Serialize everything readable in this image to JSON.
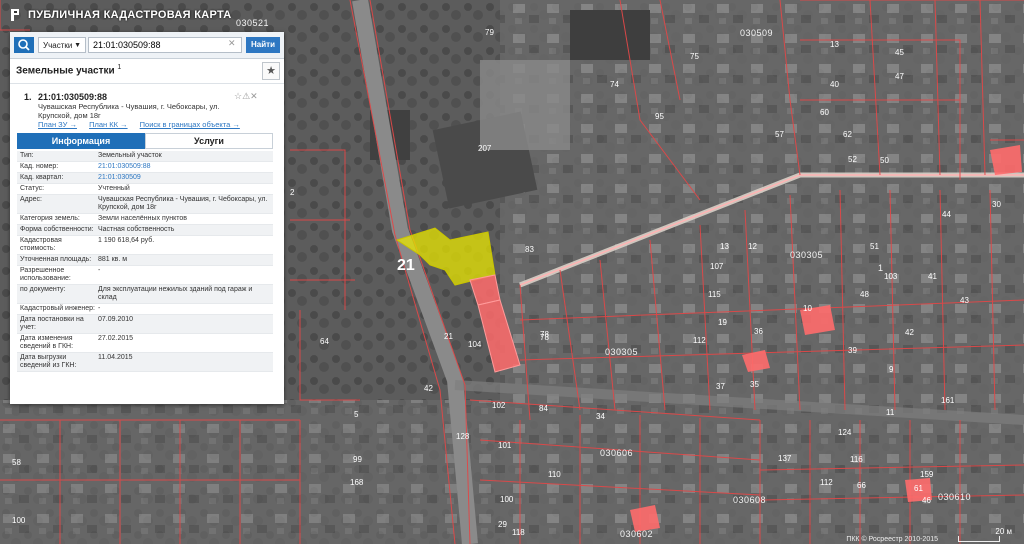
{
  "app": {
    "title": "ПУБЛИЧНАЯ КАДАСТРОВАЯ КАРТА"
  },
  "search": {
    "type": "Участки",
    "query": "21:01:030509:88",
    "find": "Найти"
  },
  "results": {
    "title": "Земельные участки",
    "count": "1",
    "item": {
      "num": "1.",
      "cad": "21:01:030509:88",
      "address": "Чувашская Республика - Чувашия, г. Чебоксары, ул. Крупской, дом 18г",
      "links": [
        "План ЗУ →",
        "План КК →",
        "Поиск в границах объекта →"
      ]
    },
    "tabs": [
      "Информация",
      "Услуги"
    ],
    "props": [
      {
        "k": "Тип:",
        "v": "Земельный участок"
      },
      {
        "k": "Кад. номер:",
        "v": "21:01:030509:88",
        "link": true
      },
      {
        "k": "Кад. квартал:",
        "v": "21:01:030509",
        "link": true
      },
      {
        "k": "Статус:",
        "v": "Учтенный"
      },
      {
        "k": "Адрес:",
        "v": "Чувашская Республика - Чувашия, г. Чебоксары, ул. Крупской, дом 18г"
      },
      {
        "k": "Категория земель:",
        "v": "Земли населённых пунктов"
      },
      {
        "k": "Форма собственности:",
        "v": "Частная собственность"
      },
      {
        "k": "Кадастровая стоимость:",
        "v": "1 190 618,64 руб."
      },
      {
        "k": "Уточненная площадь:",
        "v": "881 кв. м"
      },
      {
        "k": "Разрешенное использование:",
        "v": "-"
      },
      {
        "k": "по документу:",
        "v": "Для эксплуатации нежилых зданий под гараж и склад"
      },
      {
        "k": "Кадастровый инженер:",
        "v": "-"
      },
      {
        "k": "Дата постановки на учет:",
        "v": "07.09.2010"
      },
      {
        "k": "Дата изменения сведений в ГКН:",
        "v": "27.02.2015"
      },
      {
        "k": "Дата выгрузки сведений из ГКН:",
        "v": "11.04.2015"
      }
    ]
  },
  "map": {
    "copyright": "ПКК © Росреестр 2010-2015",
    "scale_label": "20 м",
    "district_label": "21",
    "quarter_labels": [
      "030521",
      "030509",
      "030305",
      "030305",
      "030606",
      "030602",
      "030610",
      "030608",
      "1"
    ],
    "parcel_labels": [
      "75",
      "74",
      "79",
      "83",
      "78",
      "207",
      "95",
      "107",
      "45",
      "47",
      "13",
      "40",
      "60",
      "62",
      "50",
      "52",
      "57",
      "2",
      "12",
      "13",
      "19",
      "35",
      "43",
      "44",
      "30",
      "51",
      "103",
      "41",
      "42",
      "48",
      "115",
      "112",
      "36",
      "37",
      "39",
      "9",
      "10",
      "11",
      "161",
      "159",
      "124",
      "137",
      "116",
      "112",
      "66",
      "61",
      "46",
      "101",
      "102",
      "104",
      "78",
      "42",
      "84",
      "34",
      "100",
      "110",
      "118",
      "128",
      "99",
      "168",
      "5",
      "64",
      "58",
      "100",
      "29",
      "21"
    ],
    "colors": {
      "selected": "#e8e600",
      "highlight": "#ff6b6b",
      "boundary": "#e04848",
      "accent": "#2d77c2"
    }
  }
}
